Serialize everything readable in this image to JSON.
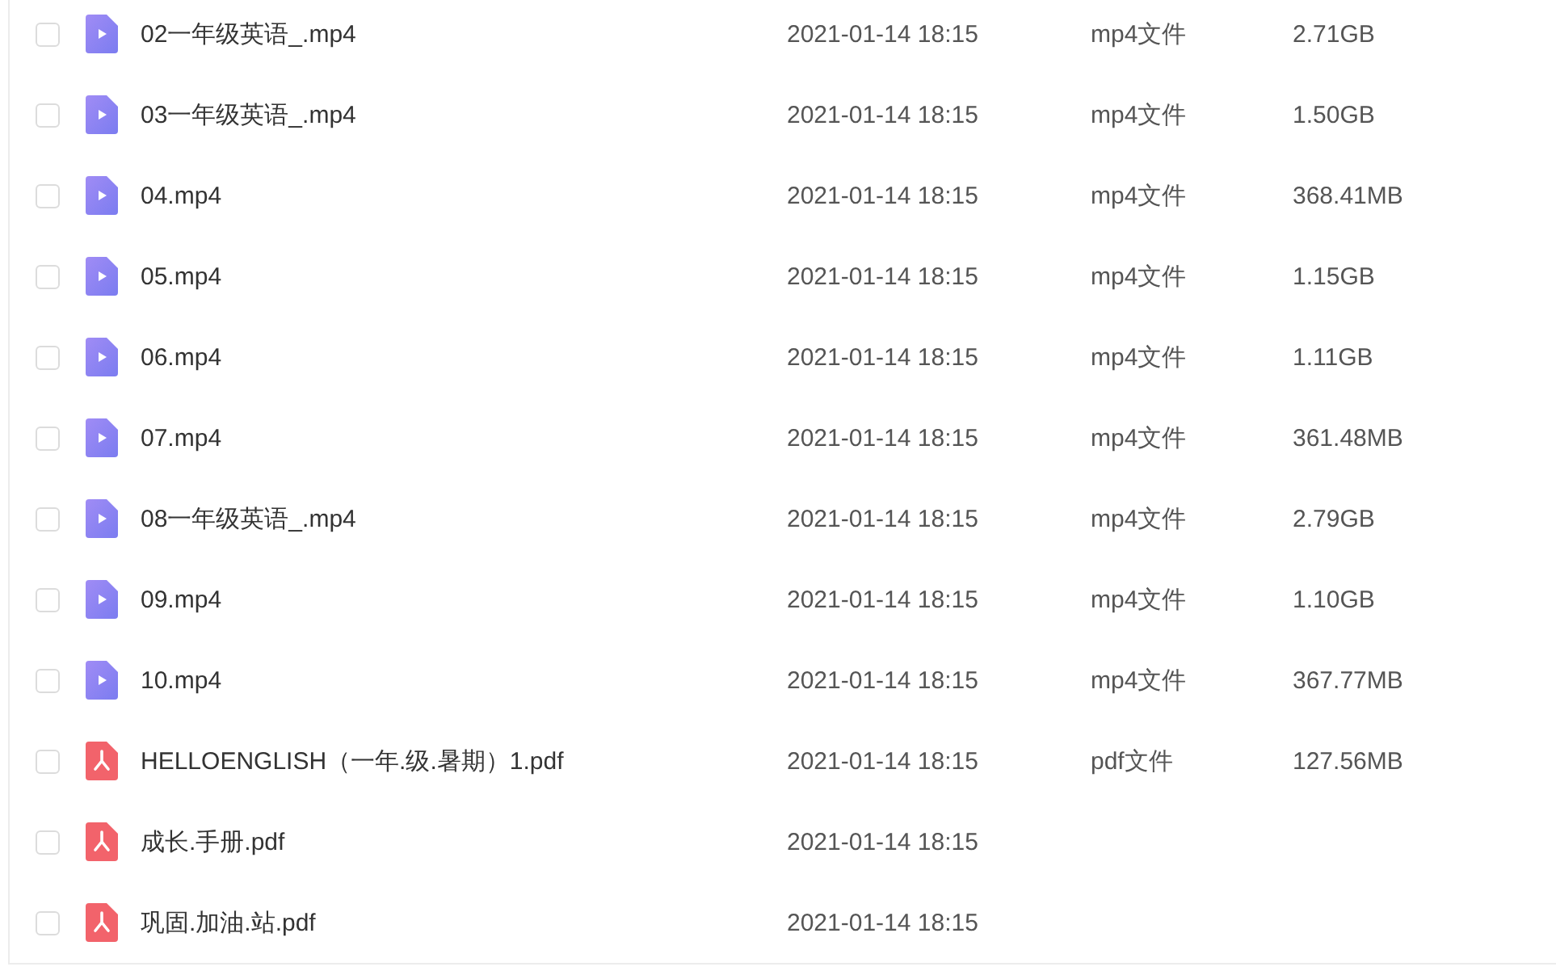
{
  "files": [
    {
      "kind": "video",
      "checked": false,
      "name": "02一年级英语_.mp4",
      "date": "2021-01-14 18:15",
      "type": "mp4文件",
      "size": "2.71GB"
    },
    {
      "kind": "video",
      "checked": false,
      "name": "03一年级英语_.mp4",
      "date": "2021-01-14 18:15",
      "type": "mp4文件",
      "size": "1.50GB"
    },
    {
      "kind": "video",
      "checked": false,
      "name": "04.mp4",
      "date": "2021-01-14 18:15",
      "type": "mp4文件",
      "size": "368.41MB"
    },
    {
      "kind": "video",
      "checked": false,
      "name": "05.mp4",
      "date": "2021-01-14 18:15",
      "type": "mp4文件",
      "size": "1.15GB"
    },
    {
      "kind": "video",
      "checked": false,
      "name": "06.mp4",
      "date": "2021-01-14 18:15",
      "type": "mp4文件",
      "size": "1.11GB"
    },
    {
      "kind": "video",
      "checked": false,
      "name": "07.mp4",
      "date": "2021-01-14 18:15",
      "type": "mp4文件",
      "size": "361.48MB"
    },
    {
      "kind": "video",
      "checked": false,
      "name": "08一年级英语_.mp4",
      "date": "2021-01-14 18:15",
      "type": "mp4文件",
      "size": "2.79GB"
    },
    {
      "kind": "video",
      "checked": false,
      "name": "09.mp4",
      "date": "2021-01-14 18:15",
      "type": "mp4文件",
      "size": "1.10GB"
    },
    {
      "kind": "video",
      "checked": false,
      "name": "10.mp4",
      "date": "2021-01-14 18:15",
      "type": "mp4文件",
      "size": "367.77MB"
    },
    {
      "kind": "pdf",
      "checked": false,
      "name": "HELLOENGLISH（一年.级.暑期）1.pdf",
      "date": "2021-01-14 18:15",
      "type": "pdf文件",
      "size": "127.56MB"
    },
    {
      "kind": "pdf",
      "checked": false,
      "name": "成长.手册.pdf",
      "date": "2021-01-14 18:15"
    },
    {
      "kind": "pdf",
      "checked": false,
      "name": "巩固.加油.站.pdf",
      "date": "2021-01-14 18:15"
    }
  ]
}
